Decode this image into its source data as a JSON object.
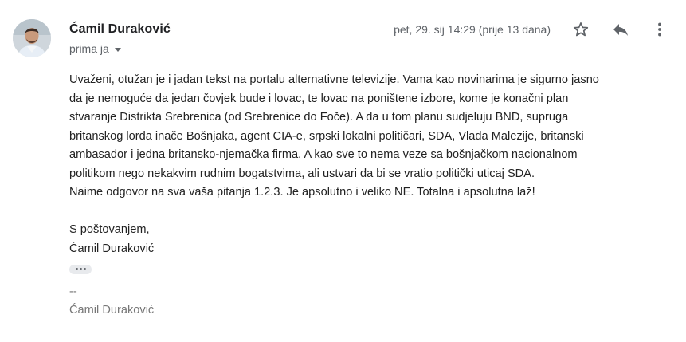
{
  "sender": {
    "name": "Ćamil Duraković",
    "recipient_label": "prima ja"
  },
  "date": "pet, 29. sij 14:29 (prije 13 dana)",
  "actions": {
    "star_icon": "star-outline-icon",
    "reply_icon": "reply-icon",
    "more_icon": "more-vert-icon"
  },
  "message": {
    "lines": [
      "Uvaženi, otužan je i jadan tekst na portalu alternativne televizije. Vama kao novinarima je sigurno jasno",
      "da je nemoguće da jedan čovjek bude i lovac, te lovac na poništene izbore, kome je konačni plan",
      "stvaranje Distrikta Srebrenica (od Srebrenice do Foče). A da u tom planu sudjeluju BND, supruga",
      "britanskog lorda inače Bošnjaka, agent CIA-e, srpski lokalni političari, SDA, Vlada Malezije, britanski",
      "ambasador i jedna britansko-njemačka firma. A kao sve to nema veze sa bošnjačkom nacionalnom",
      "politikom nego nekakvim rudnim bogatstvima, ali ustvari da bi se vratio politički uticaj SDA.",
      "Naime odgovor na sva vaša pitanja 1.2.3. Je apsolutno i veliko NE. Totalna i apsolutna laž!"
    ],
    "closing": "S poštovanjem,",
    "closing_name": "Ćamil Duraković"
  },
  "signature": {
    "separator": "--",
    "name": "Ćamil Duraković"
  },
  "colors": {
    "name": "#202124",
    "meta": "#5f6368",
    "body": "#222222",
    "signature": "#777777"
  }
}
